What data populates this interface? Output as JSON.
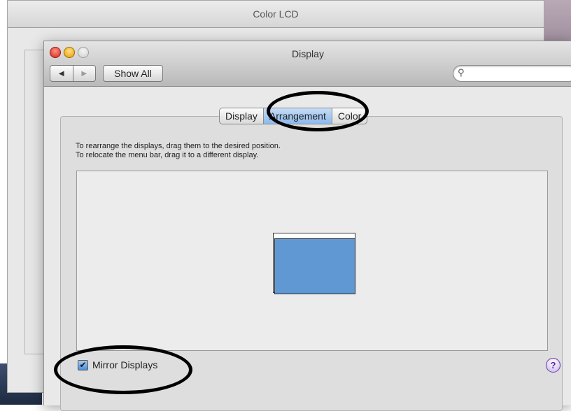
{
  "background_window": {
    "title": "Color LCD"
  },
  "window": {
    "title": "Display",
    "back_icon": "◀",
    "forward_icon": "▶",
    "show_all_label": "Show All",
    "search_placeholder": "",
    "search_icon": "🔍"
  },
  "tabs": [
    {
      "label": "Display",
      "active": false
    },
    {
      "label": "Arrangement",
      "active": true
    },
    {
      "label": "Color",
      "active": false
    }
  ],
  "instructions": {
    "line1": "To rearrange the displays, drag them to the desired position.",
    "line2": "To relocate the menu bar, drag it to a different display."
  },
  "mirror_displays": {
    "label": "Mirror Displays",
    "checked": true,
    "check_glyph": "✔"
  },
  "help": {
    "glyph": "?"
  },
  "colors": {
    "display_blue": "#5f98d3",
    "tab_active": "#8cb9ec"
  }
}
